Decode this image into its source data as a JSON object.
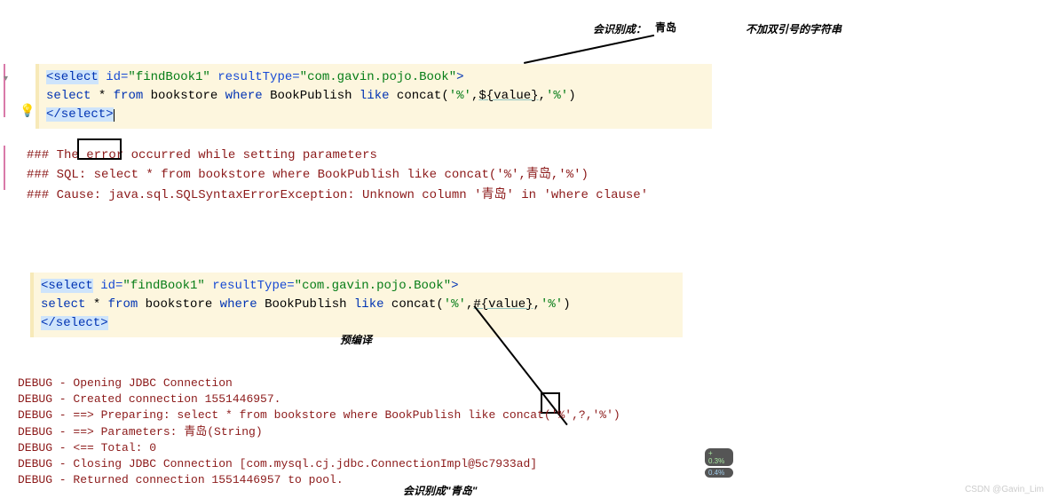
{
  "labels": {
    "recognizeAs": "会识别成：",
    "qingdao": "青岛",
    "noQuoteString": "不加双引号的字符串",
    "precompile": "预编译",
    "recognizeAsQingdao": "会识别成\"青岛\""
  },
  "code1": {
    "line1": {
      "open": "<select",
      "idAttr": " id=",
      "idVal": "\"findBook1\"",
      "rtAttr": " resultType=",
      "rtVal": "\"com.gavin.pojo.Book\"",
      "close": ">"
    },
    "line2": {
      "pre": "    ",
      "select": "select",
      "star": " * ",
      "from": "from",
      "bookstore": " bookstore ",
      "where": "where",
      "col": " BookPublish ",
      "like": "like",
      "concat": " concat(",
      "q1": "'%'",
      "comma1": ",",
      "param": "${value}",
      "comma2": ",",
      "q2": "'%'",
      "rparen": ")"
    },
    "line3": "</select>"
  },
  "error": {
    "l1a": "### The ",
    "l1b": "error ",
    "l1c": "occurred while setting parameters",
    "l2": "### SQL: select * from bookstore where BookPublish like concat('%',青岛,'%')",
    "l3": "### Cause: java.sql.SQLSyntaxErrorException: Unknown column '青岛' in 'where clause'"
  },
  "code2": {
    "line1": {
      "open": "<select",
      "idAttr": " id=",
      "idVal": "\"findBook1\"",
      "rtAttr": " resultType=",
      "rtVal": "\"com.gavin.pojo.Book\"",
      "close": ">"
    },
    "line2": {
      "pre": "    ",
      "select": "select",
      "star": " * ",
      "from": "from",
      "bookstore": " bookstore ",
      "where": "where",
      "col": " BookPublish ",
      "like": "like",
      "concat": " concat(",
      "q1": "'%'",
      "comma1": ",",
      "param": "#{value}",
      "comma2": ",",
      "q2": "'%'",
      "rparen": ")"
    },
    "line3": "</select>"
  },
  "debug": {
    "l1": "DEBUG - Opening JDBC Connection",
    "l2": "DEBUG - Created connection 1551446957.",
    "l3": "DEBUG - ==>  Preparing: select * from bookstore where BookPublish like concat('%',?,'%')",
    "l4": "DEBUG - ==> Parameters: 青岛(String)",
    "l5": "DEBUG - <==      Total: 0",
    "l6": "DEBUG - Closing JDBC Connection [com.mysql.cj.jdbc.ConnectionImpl@5c7933ad]",
    "l7": "DEBUG - Returned connection 1551446957 to pool."
  },
  "badges": {
    "a": "+ 0.3%",
    "b": "0.4%"
  },
  "watermark": "CSDN @Gavin_Lim"
}
